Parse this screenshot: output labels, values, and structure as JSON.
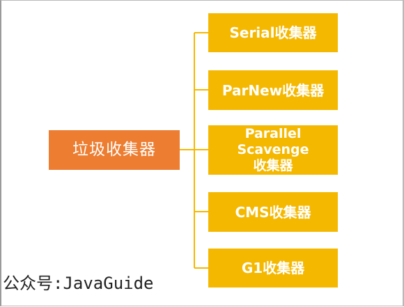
{
  "root": {
    "label": "垃圾收集器"
  },
  "collectors": [
    {
      "label": "Serial收集器"
    },
    {
      "label": "ParNew收集器"
    },
    {
      "line1": "Parallel Scavenge",
      "line2": "收集器"
    },
    {
      "label": "CMS收集器"
    },
    {
      "label": "G1收集器"
    }
  ],
  "watermark": "公众号:JavaGuide",
  "colors": {
    "root_fill": "#ED7D31",
    "leaf_fill": "#F5B800",
    "connector": "#F5B800",
    "text": "#ffffff"
  }
}
